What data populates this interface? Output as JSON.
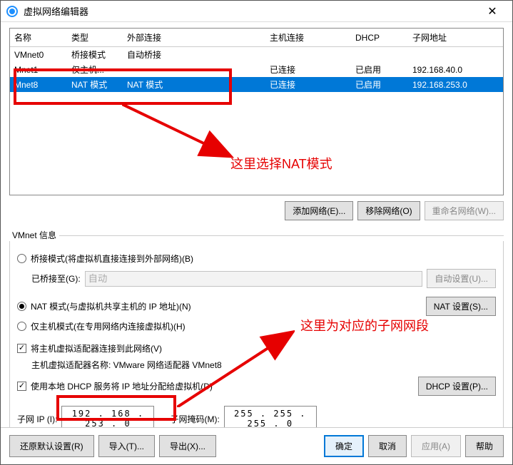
{
  "window": {
    "title": "虚拟网络编辑器"
  },
  "table": {
    "headers": [
      "名称",
      "类型",
      "外部连接",
      "主机连接",
      "DHCP",
      "子网地址"
    ],
    "rows": [
      {
        "name": "VMnet0",
        "type": "桥接模式",
        "ext": "自动桥接",
        "host": "",
        "dhcp": "",
        "subnet": ""
      },
      {
        "name": "Mnet1",
        "type": "仅主机...",
        "ext": "-",
        "host": "已连接",
        "dhcp": "已启用",
        "subnet": "192.168.40.0"
      },
      {
        "name": "Mnet8",
        "type": "NAT 模式",
        "ext": "NAT 模式",
        "host": "已连接",
        "dhcp": "已启用",
        "subnet": "192.168.253.0"
      }
    ]
  },
  "annotations": {
    "sel_nat": "这里选择NAT模式",
    "subnet_note": "这里为对应的子网网段"
  },
  "buttons": {
    "add_net": "添加网络(E)...",
    "remove_net": "移除网络(O)",
    "rename_net": "重命名网络(W)...",
    "auto_set": "自动设置(U)...",
    "nat_set": "NAT 设置(S)...",
    "dhcp_set": "DHCP 设置(P)...",
    "restore": "还原默认设置(R)",
    "import": "导入(T)...",
    "export": "导出(X)...",
    "ok": "确定",
    "cancel": "取消",
    "apply": "应用(A)",
    "help": "帮助"
  },
  "group": {
    "title": "VMnet 信息",
    "bridge": "桥接模式(将虚拟机直接连接到外部网络)(B)",
    "bridged_to_label": "已桥接至(G):",
    "bridged_to_value": "自动",
    "nat": "NAT 模式(与虚拟机共享主机的 IP 地址)(N)",
    "hostonly": "仅主机模式(在专用网络内连接虚拟机)(H)",
    "connect_host": "将主机虚拟适配器连接到此网络(V)",
    "adapter_label": "主机虚拟适配器名称: VMware 网络适配器 VMnet8",
    "use_dhcp": "使用本地 DHCP 服务将 IP 地址分配给虚拟机(D)",
    "subnet_ip_label": "子网 IP (I):",
    "subnet_ip": "192 . 168 . 253 .   0",
    "subnet_mask_label": "子网掩码(M):",
    "subnet_mask": "255 . 255 . 255 .   0"
  }
}
